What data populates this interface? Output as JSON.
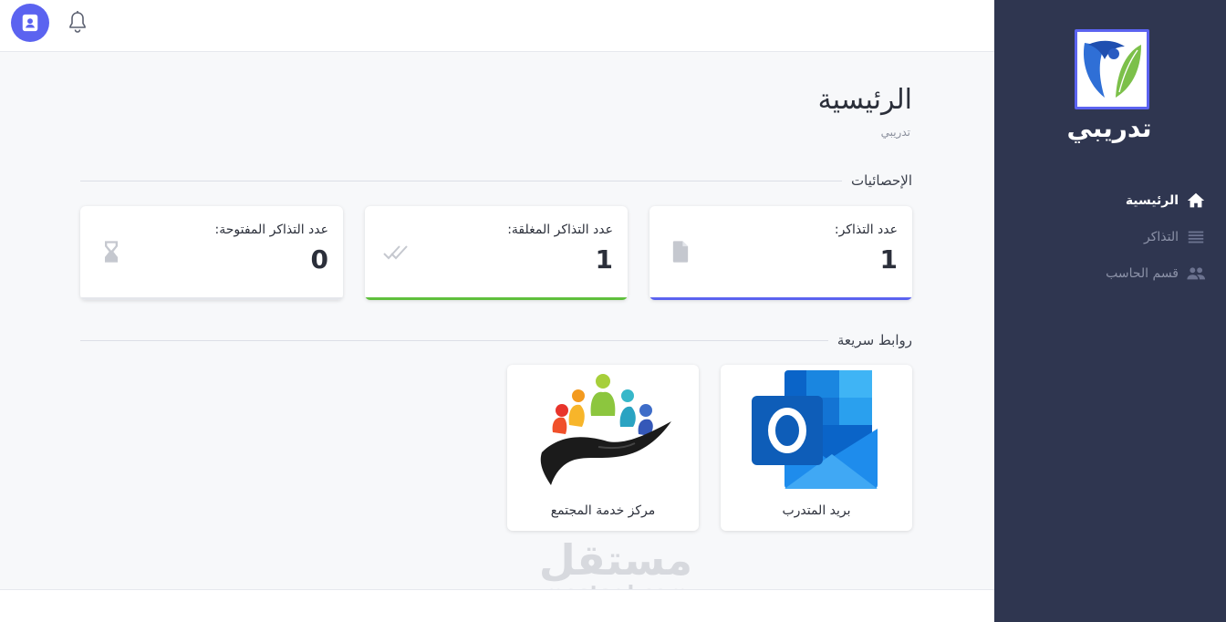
{
  "sidebar": {
    "brand_name": "تدريبي",
    "items": [
      {
        "label": "الرئيسية",
        "icon": "home-icon",
        "active": true
      },
      {
        "label": "التذاكر",
        "icon": "list-icon",
        "active": false
      },
      {
        "label": "قسم الحاسب",
        "icon": "group-icon",
        "active": false
      }
    ]
  },
  "topbar": {
    "profile_icon": "contact-card-icon",
    "notification_icon": "bell-icon"
  },
  "page": {
    "title": "الرئيسية",
    "subtitle": "تدريبي"
  },
  "stats_section": {
    "heading": "الإحصائيات",
    "cards": [
      {
        "label": "عدد التذاكر:",
        "value": "1",
        "icon": "file-icon",
        "accent": "#5b63f0"
      },
      {
        "label": "عدد التذاكر المغلقة:",
        "value": "1",
        "icon": "double-check-icon",
        "accent": "#5fbf3c"
      },
      {
        "label": "عدد التذاكر المفتوحة:",
        "value": "0",
        "icon": "hourglass-icon",
        "accent": "#ffffff"
      }
    ]
  },
  "links_section": {
    "heading": "روابط سريعة",
    "links": [
      {
        "label": "بريد المتدرب",
        "icon": "outlook-icon"
      },
      {
        "label": "مركز خدمة المجتمع",
        "icon": "community-hands-icon"
      }
    ]
  },
  "watermark": {
    "arabic": "مستقل",
    "latin": "mostaql.com"
  },
  "colors": {
    "sidebar_bg": "#2f3650",
    "accent": "#5b63f0",
    "success": "#5fbf3c",
    "page_bg": "#f7f8fa"
  }
}
